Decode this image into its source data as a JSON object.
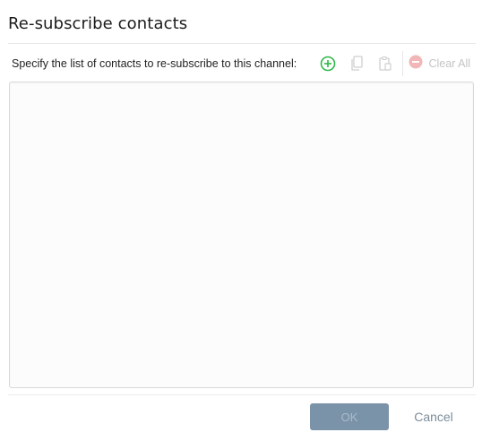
{
  "dialog": {
    "title": "Re-subscribe contacts"
  },
  "toolbar": {
    "instruction": "Specify the list of contacts to re-subscribe to this channel:",
    "icons": {
      "add": "add-circle-icon",
      "copy": "copy-icon",
      "paste": "paste-icon",
      "remove": "remove-circle-icon"
    },
    "clear_all_label": "Clear All"
  },
  "contacts": {
    "value": ""
  },
  "footer": {
    "ok_label": "OK",
    "cancel_label": "Cancel"
  },
  "colors": {
    "add_icon": "#2eb84a",
    "disabled_icon": "#cfcfcf",
    "remove_icon": "#f2b6b6",
    "ok_button_bg": "#7a93a8",
    "ok_button_text": "#a9bccb",
    "cancel_text": "#7c8d9b"
  }
}
